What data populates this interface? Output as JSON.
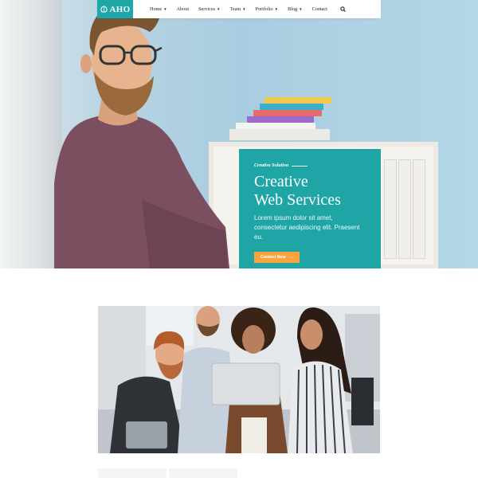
{
  "brand": {
    "name": "AHO",
    "accent": "#1ea7a8",
    "cta_color": "#f9a43d"
  },
  "nav": {
    "items": [
      {
        "label": "Home",
        "dropdown": true
      },
      {
        "label": "About",
        "dropdown": false
      },
      {
        "label": "Services",
        "dropdown": true
      },
      {
        "label": "Team",
        "dropdown": true
      },
      {
        "label": "Portfolio",
        "dropdown": true
      },
      {
        "label": "Blog",
        "dropdown": true
      },
      {
        "label": "Contact",
        "dropdown": false
      }
    ],
    "search_icon": "search-icon",
    "caret_icon": "caret-down-icon"
  },
  "hero": {
    "eyebrow": "Creative Solution",
    "headline_line1": "Creative",
    "headline_line2": "Web Services",
    "description": "Lorem ipsum dolor sit amet, consectetur aedipiscing elit. Praesent eu.",
    "cta_label": "Contact Now",
    "cta_icon": "arrow-right-icon"
  },
  "images": {
    "hero_photo": "man-with-glasses-photo",
    "team_photo": "team-with-laptop-photo"
  }
}
